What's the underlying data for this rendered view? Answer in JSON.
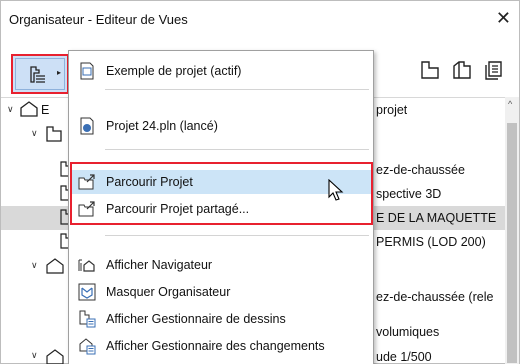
{
  "window": {
    "title": "Organisateur - Editeur de Vues",
    "close_glyph": "✕"
  },
  "toolbar": {
    "menu_button_icon": "view-map-icon",
    "dropdown_glyph": "▸"
  },
  "tree": {
    "rows": [
      {
        "text": "E",
        "text2": "projet"
      },
      {
        "text": "",
        "text2": ""
      },
      {
        "text": "",
        "text2": "ez-de-chaussée"
      },
      {
        "text": "",
        "text2": "spective 3D"
      },
      {
        "text": "",
        "text2": "E DE LA MAQUETTE"
      },
      {
        "text": "",
        "text2": "PERMIS (LOD 200)"
      },
      {
        "text": "",
        "text2": ""
      },
      {
        "text": "",
        "text2": "ez-de-chaussée (rele"
      },
      {
        "text": "",
        "text2": "volumiques"
      },
      {
        "text": "",
        "text2": "ude 1/500"
      }
    ]
  },
  "menu": {
    "items": [
      {
        "label": "Exemple de projet (actif)",
        "icon": "project-file-icon"
      },
      {
        "label": "Projet 24.pln (lancé)",
        "icon": "pln-file-icon"
      },
      {
        "label": "Parcourir Projet",
        "icon": "browse-folder-icon"
      },
      {
        "label": "Parcourir Projet partagé...",
        "icon": "browse-shared-folder-icon"
      },
      {
        "label": "Afficher Navigateur",
        "icon": "navigator-icon"
      },
      {
        "label": "Masquer Organisateur",
        "icon": "organizer-icon"
      },
      {
        "label": "Afficher Gestionnaire de dessins",
        "icon": "drawing-manager-icon"
      },
      {
        "label": "Afficher Gestionnaire des changements",
        "icon": "change-manager-icon"
      }
    ]
  },
  "colors": {
    "accent_red": "#e8212f",
    "selection": "#cce4f7",
    "toolbar_active": "#cde0f6",
    "row_highlight": "#d9d9d9"
  }
}
